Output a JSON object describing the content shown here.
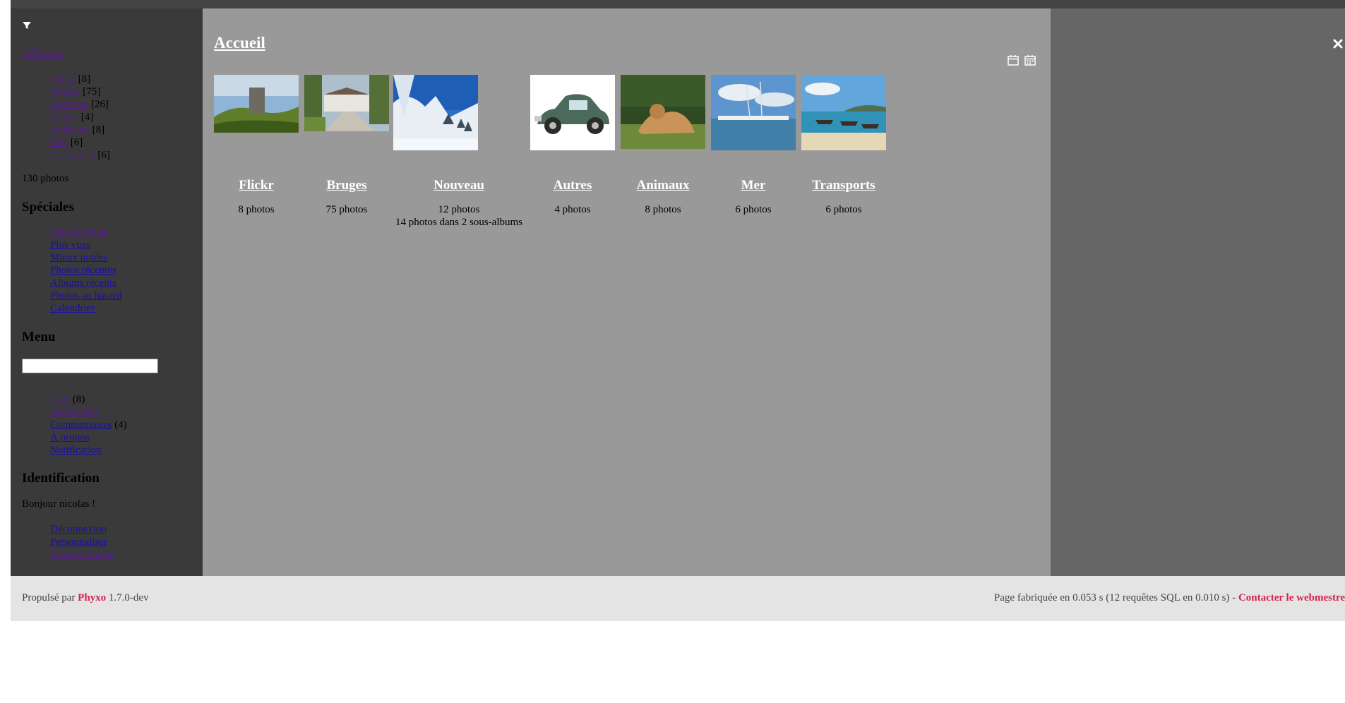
{
  "colors": {
    "brand": "#d62150",
    "sidebar_bg": "#3a3a3a",
    "content_bg": "#999999",
    "right_bg": "#666666",
    "footer_bg": "#e4e4e4"
  },
  "sidebar": {
    "albums_title": "Albums",
    "albums": [
      {
        "label": "Flickr",
        "count": " [8]"
      },
      {
        "label": "Bruges",
        "count": " [75]"
      },
      {
        "label": "Nouveau",
        "count": " [26]"
      },
      {
        "label": "Autres",
        "count": " [4]"
      },
      {
        "label": "Animaux",
        "count": " [8]"
      },
      {
        "label": "Mer",
        "count": " [6]"
      },
      {
        "label": "Transports",
        "count": " [6]"
      }
    ],
    "total_photos": "130 photos",
    "speciales_title": "Spéciales",
    "speciales": [
      {
        "label": "Mes favorites",
        "visited": true
      },
      {
        "label": "Plus vues",
        "visited": false
      },
      {
        "label": "Mieux notées",
        "visited": false
      },
      {
        "label": "Photos récentes",
        "visited": false
      },
      {
        "label": "Albums récents",
        "visited": false
      },
      {
        "label": "Photos au hasard",
        "visited": false
      },
      {
        "label": "Calendrier",
        "visited": false
      }
    ],
    "menu_title": "Menu",
    "search_value": "",
    "menu": [
      {
        "label": "Tags",
        "count": " (8)",
        "visited": true
      },
      {
        "label": "Rechercher",
        "count": "",
        "visited": true
      },
      {
        "label": "Commentaires",
        "count": " (4)",
        "visited": false
      },
      {
        "label": "À propos",
        "count": "",
        "visited": false
      },
      {
        "label": "Notification",
        "count": "",
        "visited": false
      }
    ],
    "ident_title": "Identification",
    "greeting": "Bonjour nicolas !",
    "ident": [
      {
        "label": "Déconnexion",
        "visited": false
      },
      {
        "label": "Personnaliser",
        "visited": false
      },
      {
        "label": "Administration",
        "visited": true
      }
    ]
  },
  "main": {
    "title": "Accueil",
    "albums": [
      {
        "name": "Flickr",
        "count": "8 photos",
        "sub": ""
      },
      {
        "name": "Bruges",
        "count": "75 photos",
        "sub": ""
      },
      {
        "name": "Nouveau",
        "count": "12 photos",
        "sub": "14 photos dans 2 sous-albums"
      },
      {
        "name": "Autres",
        "count": "4 photos",
        "sub": ""
      },
      {
        "name": "Animaux",
        "count": "8 photos",
        "sub": ""
      },
      {
        "name": "Mer",
        "count": "6 photos",
        "sub": ""
      },
      {
        "name": "Transports",
        "count": "6 photos",
        "sub": ""
      }
    ]
  },
  "footer": {
    "powered_prefix": "Propulsé par ",
    "brand": "Phyxo",
    "version": " 1.7.0-dev",
    "stats": "Page fabriquée en 0.053 s (12 requêtes SQL en 0.010 s) - ",
    "contact": "Contacter le webmestre"
  }
}
